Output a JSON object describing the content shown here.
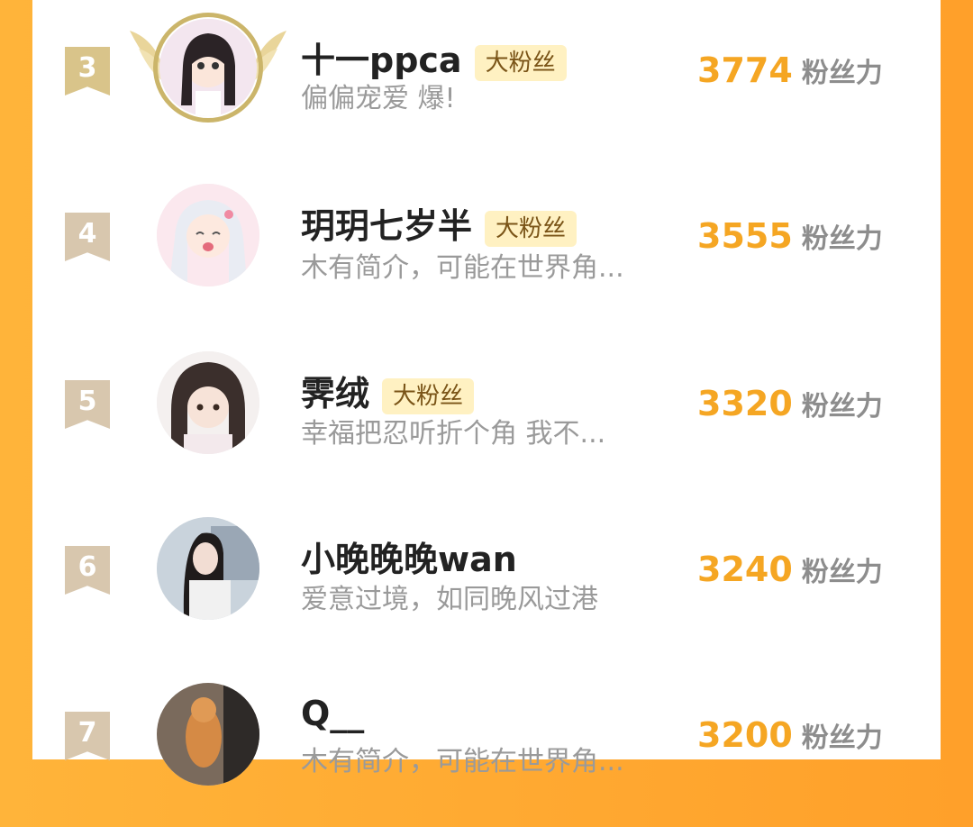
{
  "leaderboard": {
    "badge_label": "大粉丝",
    "unit_label": "粉丝力",
    "rows": [
      {
        "rank": "3",
        "name": "十一ppca",
        "badge": "大粉丝",
        "bio": "偏偏宠爱 爆!",
        "score": "3774"
      },
      {
        "rank": "4",
        "name": "玥玥七岁半",
        "badge": "大粉丝",
        "bio": "木有简介，可能在世界角...",
        "score": "3555"
      },
      {
        "rank": "5",
        "name": "霁绒",
        "badge": "大粉丝",
        "bio": "幸福把忍听折个角 我不...",
        "score": "3320"
      },
      {
        "rank": "6",
        "name": "小晚晚晚wan",
        "badge": "",
        "bio": "爱意过境，如同晚风过港",
        "score": "3240"
      },
      {
        "rank": "7",
        "name": "Q__",
        "badge": "",
        "bio": "木有简介，可能在世界角...",
        "score": "3200"
      }
    ]
  },
  "colors": {
    "accent_orange": "#f5a623",
    "side_background": "#ffa02a",
    "badge_bg": "#fff1c2",
    "flag": "#d8c7ae"
  },
  "icons": [
    "rank-ribbon-icon",
    "wings-crown-frame-icon"
  ]
}
